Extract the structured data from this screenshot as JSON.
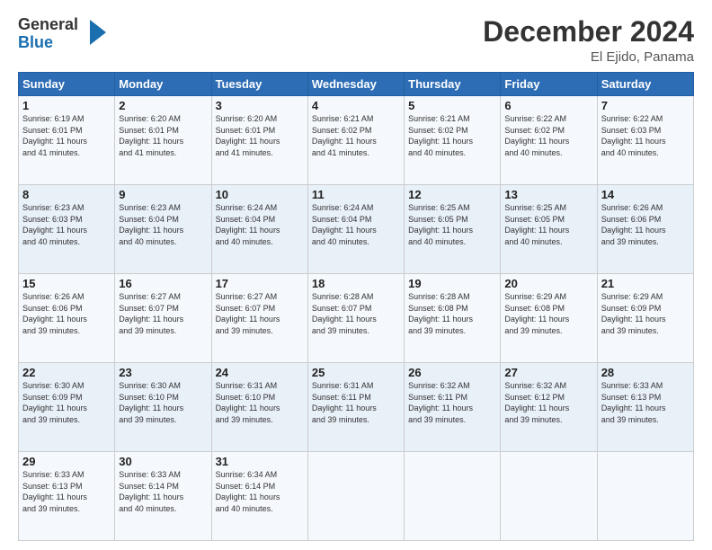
{
  "header": {
    "logo_line1": "General",
    "logo_line2": "Blue",
    "month": "December 2024",
    "location": "El Ejido, Panama"
  },
  "weekdays": [
    "Sunday",
    "Monday",
    "Tuesday",
    "Wednesday",
    "Thursday",
    "Friday",
    "Saturday"
  ],
  "weeks": [
    [
      {
        "day": "1",
        "info": "Sunrise: 6:19 AM\nSunset: 6:01 PM\nDaylight: 11 hours\nand 41 minutes."
      },
      {
        "day": "2",
        "info": "Sunrise: 6:20 AM\nSunset: 6:01 PM\nDaylight: 11 hours\nand 41 minutes."
      },
      {
        "day": "3",
        "info": "Sunrise: 6:20 AM\nSunset: 6:01 PM\nDaylight: 11 hours\nand 41 minutes."
      },
      {
        "day": "4",
        "info": "Sunrise: 6:21 AM\nSunset: 6:02 PM\nDaylight: 11 hours\nand 41 minutes."
      },
      {
        "day": "5",
        "info": "Sunrise: 6:21 AM\nSunset: 6:02 PM\nDaylight: 11 hours\nand 40 minutes."
      },
      {
        "day": "6",
        "info": "Sunrise: 6:22 AM\nSunset: 6:02 PM\nDaylight: 11 hours\nand 40 minutes."
      },
      {
        "day": "7",
        "info": "Sunrise: 6:22 AM\nSunset: 6:03 PM\nDaylight: 11 hours\nand 40 minutes."
      }
    ],
    [
      {
        "day": "8",
        "info": "Sunrise: 6:23 AM\nSunset: 6:03 PM\nDaylight: 11 hours\nand 40 minutes."
      },
      {
        "day": "9",
        "info": "Sunrise: 6:23 AM\nSunset: 6:04 PM\nDaylight: 11 hours\nand 40 minutes."
      },
      {
        "day": "10",
        "info": "Sunrise: 6:24 AM\nSunset: 6:04 PM\nDaylight: 11 hours\nand 40 minutes."
      },
      {
        "day": "11",
        "info": "Sunrise: 6:24 AM\nSunset: 6:04 PM\nDaylight: 11 hours\nand 40 minutes."
      },
      {
        "day": "12",
        "info": "Sunrise: 6:25 AM\nSunset: 6:05 PM\nDaylight: 11 hours\nand 40 minutes."
      },
      {
        "day": "13",
        "info": "Sunrise: 6:25 AM\nSunset: 6:05 PM\nDaylight: 11 hours\nand 40 minutes."
      },
      {
        "day": "14",
        "info": "Sunrise: 6:26 AM\nSunset: 6:06 PM\nDaylight: 11 hours\nand 39 minutes."
      }
    ],
    [
      {
        "day": "15",
        "info": "Sunrise: 6:26 AM\nSunset: 6:06 PM\nDaylight: 11 hours\nand 39 minutes."
      },
      {
        "day": "16",
        "info": "Sunrise: 6:27 AM\nSunset: 6:07 PM\nDaylight: 11 hours\nand 39 minutes."
      },
      {
        "day": "17",
        "info": "Sunrise: 6:27 AM\nSunset: 6:07 PM\nDaylight: 11 hours\nand 39 minutes."
      },
      {
        "day": "18",
        "info": "Sunrise: 6:28 AM\nSunset: 6:07 PM\nDaylight: 11 hours\nand 39 minutes."
      },
      {
        "day": "19",
        "info": "Sunrise: 6:28 AM\nSunset: 6:08 PM\nDaylight: 11 hours\nand 39 minutes."
      },
      {
        "day": "20",
        "info": "Sunrise: 6:29 AM\nSunset: 6:08 PM\nDaylight: 11 hours\nand 39 minutes."
      },
      {
        "day": "21",
        "info": "Sunrise: 6:29 AM\nSunset: 6:09 PM\nDaylight: 11 hours\nand 39 minutes."
      }
    ],
    [
      {
        "day": "22",
        "info": "Sunrise: 6:30 AM\nSunset: 6:09 PM\nDaylight: 11 hours\nand 39 minutes."
      },
      {
        "day": "23",
        "info": "Sunrise: 6:30 AM\nSunset: 6:10 PM\nDaylight: 11 hours\nand 39 minutes."
      },
      {
        "day": "24",
        "info": "Sunrise: 6:31 AM\nSunset: 6:10 PM\nDaylight: 11 hours\nand 39 minutes."
      },
      {
        "day": "25",
        "info": "Sunrise: 6:31 AM\nSunset: 6:11 PM\nDaylight: 11 hours\nand 39 minutes."
      },
      {
        "day": "26",
        "info": "Sunrise: 6:32 AM\nSunset: 6:11 PM\nDaylight: 11 hours\nand 39 minutes."
      },
      {
        "day": "27",
        "info": "Sunrise: 6:32 AM\nSunset: 6:12 PM\nDaylight: 11 hours\nand 39 minutes."
      },
      {
        "day": "28",
        "info": "Sunrise: 6:33 AM\nSunset: 6:13 PM\nDaylight: 11 hours\nand 39 minutes."
      }
    ],
    [
      {
        "day": "29",
        "info": "Sunrise: 6:33 AM\nSunset: 6:13 PM\nDaylight: 11 hours\nand 39 minutes."
      },
      {
        "day": "30",
        "info": "Sunrise: 6:33 AM\nSunset: 6:14 PM\nDaylight: 11 hours\nand 40 minutes."
      },
      {
        "day": "31",
        "info": "Sunrise: 6:34 AM\nSunset: 6:14 PM\nDaylight: 11 hours\nand 40 minutes."
      },
      null,
      null,
      null,
      null
    ]
  ]
}
